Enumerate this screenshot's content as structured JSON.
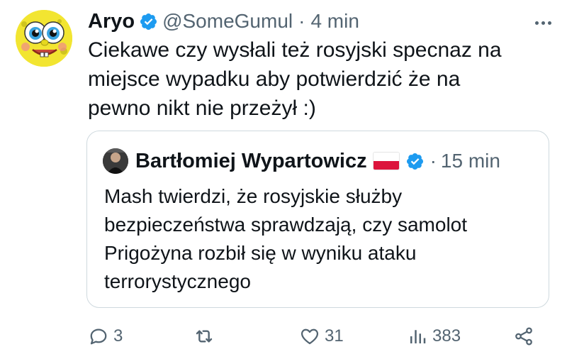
{
  "tweet": {
    "author_name": "Aryo",
    "handle": "@SomeGumul",
    "separator": "·",
    "time": "4 min",
    "text": "Ciekawe czy wysłali też rosyjski specnaz na\nmiejsce wypadku aby potwierdzić że na\npewno nikt nie przeżył :)",
    "verified_color": "#1d9bf0",
    "more_icon": "more-icon"
  },
  "quote": {
    "author_name": "Bartłomiej Wypartowicz",
    "flag_emoji_name": "poland-flag-icon",
    "separator": "·",
    "time": "15 min",
    "text": "Mash twierdzi, że rosyjskie służby\nbezpieczeństwa sprawdzają, czy samolot\nPrigożyna rozbił się w wyniku ataku\nterrorystycznego"
  },
  "actions": {
    "reply_count": "3",
    "retweet_count": "",
    "like_count": "31",
    "views_count": "383",
    "icons": [
      "reply-icon",
      "retweet-icon",
      "like-icon",
      "views-icon",
      "share-icon"
    ]
  }
}
